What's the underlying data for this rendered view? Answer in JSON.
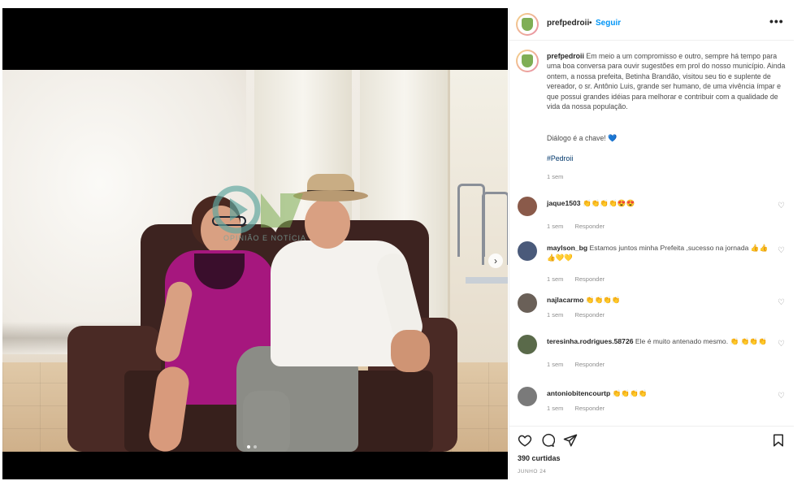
{
  "post": {
    "username": "prefpedroii",
    "separator": "•",
    "follow_label": "Seguir",
    "more_label": "•••"
  },
  "caption": {
    "username": "prefpedroii",
    "text": "Em meio a um compromisso e outro, sempre há tempo para uma boa conversa para ouvir sugestões em prol do nosso município. Ainda ontem, a nossa prefeita, Betinha Brandão, visitou seu tio e suplente de vereador, o sr. Antônio Luis, grande ser humano, de uma vivência ímpar e que possui grandes idéias para melhorar e contribuir com a qualidade de vida da nossa população.",
    "dialog_text": "Diálogo é a chave!",
    "heart": "💙",
    "hashtag": "#Pedroii",
    "time": "1 sem"
  },
  "watermark": {
    "subtitle": "OPINIÃO E NOTÍCIA"
  },
  "comments": [
    {
      "username": "jaque1503",
      "text": "👏👏👏👏😍😍",
      "time": "1 sem",
      "reply": "Responder",
      "avatar_color": "#8a5a4a"
    },
    {
      "username": "maylson_bg",
      "text": "Estamos juntos minha Prefeita ,sucesso na jornada 👍👍👍💛💛",
      "time": "1 sem",
      "reply": "Responder",
      "avatar_color": "#4a5a7a"
    },
    {
      "username": "najlacarmo",
      "text": "👏👏👏👏",
      "time": "1 sem",
      "reply": "Responder",
      "avatar_color": "#6a6058"
    },
    {
      "username": "teresinha.rodrigues.58726",
      "text": "Ele é muito antenado mesmo. 👏 👏👏👏",
      "time": "1 sem",
      "reply": "Responder",
      "avatar_color": "#5a6a4a"
    },
    {
      "username": "antoniobitencourtp",
      "text": "👏👏👏👏",
      "time": "1 sem",
      "reply": "Responder",
      "avatar_color": "#7a7a7a"
    }
  ],
  "footer": {
    "likes": "390 curtidas",
    "date": "junho 24"
  },
  "colors": {
    "accent": "#0095f6",
    "dress": "#a6177e",
    "sofa": "#3d2320"
  }
}
